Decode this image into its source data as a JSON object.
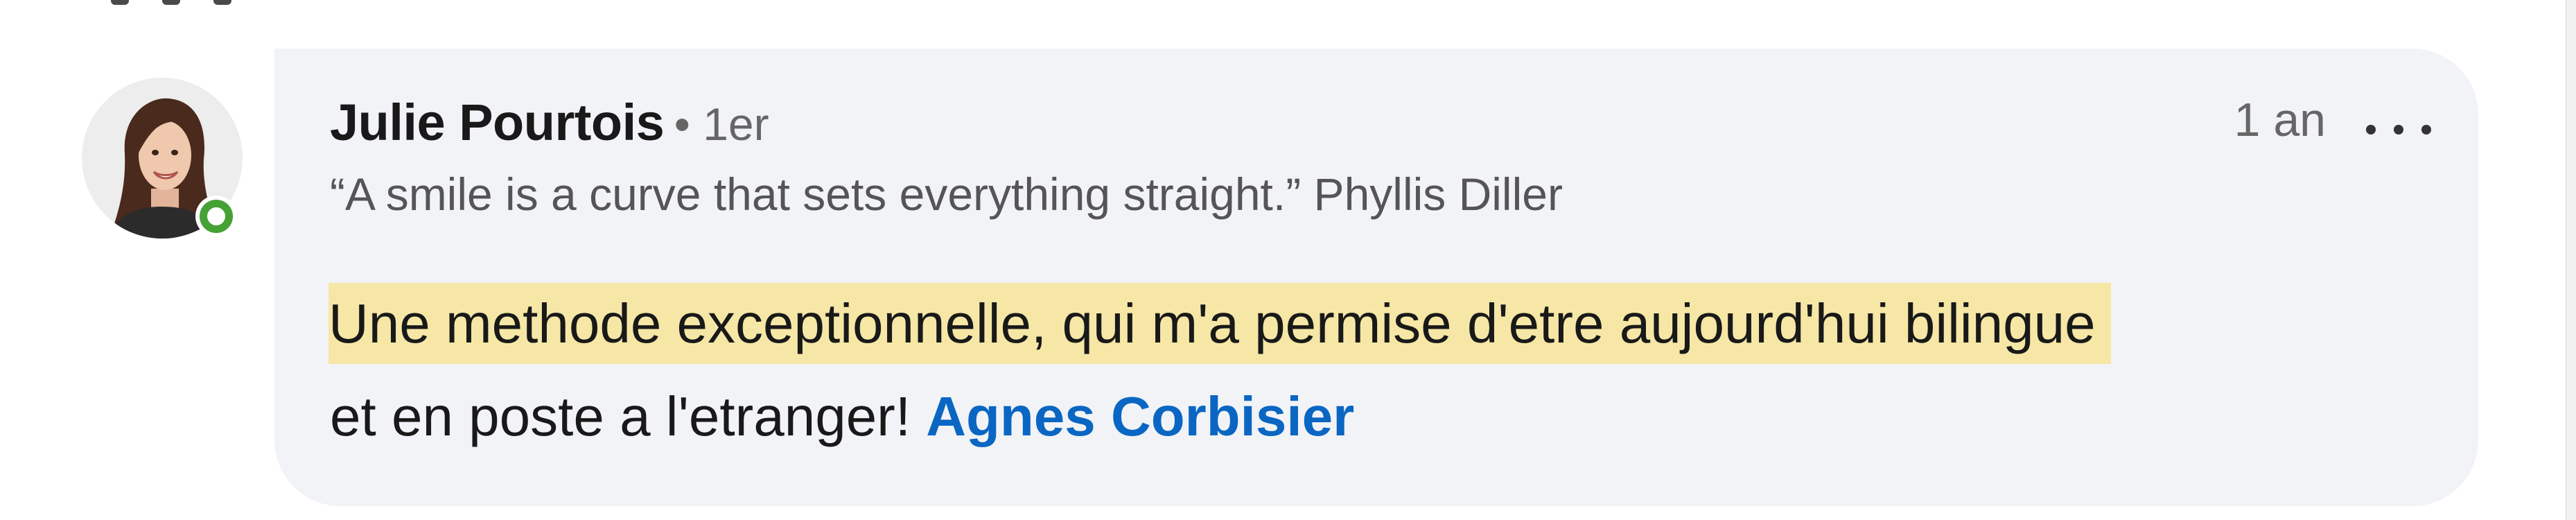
{
  "comment": {
    "author": {
      "name": "Julie Pourtois",
      "degree": "• 1er",
      "headline": "“A smile is a curve that sets everything straight.” Phyllis Diller",
      "online": true
    },
    "time_ago": "1 an",
    "more_icon": "more-horizontal-icon",
    "text": {
      "highlighted": "Une methode exceptionnelle, qui m'a permise d'etre aujourd'hui bilingue",
      "rest": "et en poste a l'etranger!",
      "mention": "Agnes Corbisier"
    }
  },
  "colors": {
    "bubble_background": "#f1f3f6",
    "highlight": "#f6e7a6",
    "mention": "#0a66c2",
    "online_status": "#44a235"
  }
}
